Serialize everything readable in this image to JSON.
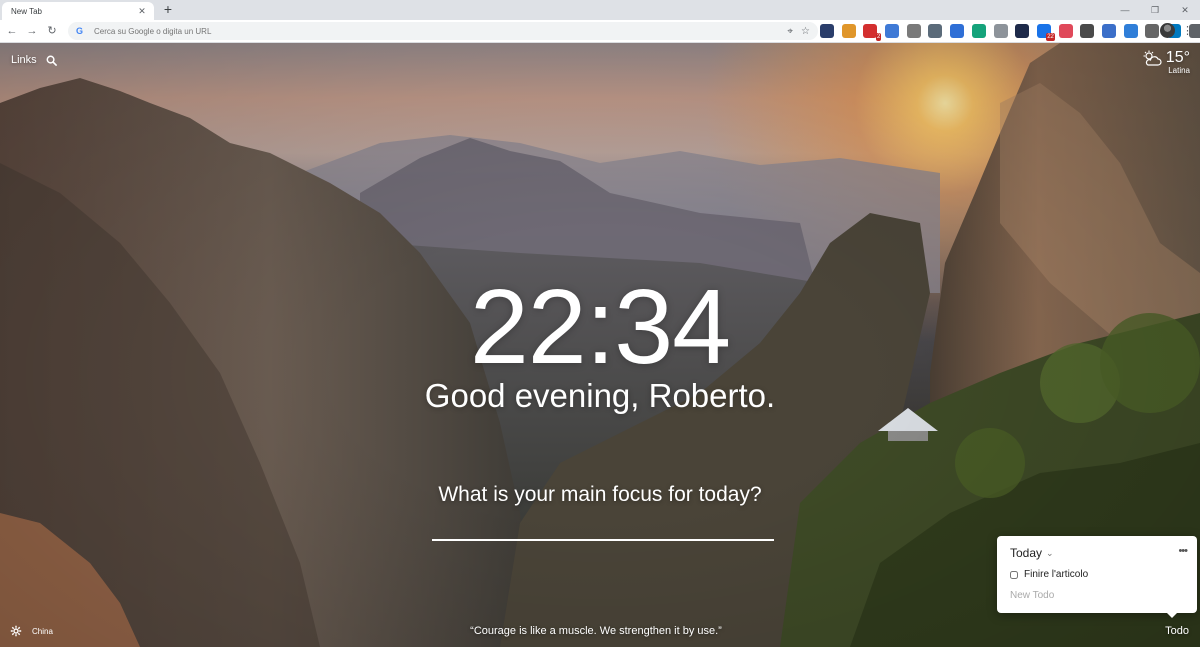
{
  "browser": {
    "tab_title": "New Tab",
    "tab_close": "✕",
    "new_tab": "+",
    "controls": {
      "minimize": "—",
      "restore": "❐",
      "close": "✕"
    },
    "nav": {
      "back": "←",
      "forward": "→",
      "reload": "↻"
    },
    "omnibox_placeholder": "Cerca su Google o digita un URL",
    "omnibox_icon": "G",
    "extensions": [
      {
        "name": "pocket-ext-icon",
        "color": "#2b3e6b",
        "badge": ""
      },
      {
        "name": "feather-ext-icon",
        "color": "#e0962a",
        "badge": ""
      },
      {
        "name": "red-ext-icon",
        "color": "#d32f2f",
        "badge": "2"
      },
      {
        "name": "blue-ext-icon",
        "color": "#3f7ad6",
        "badge": ""
      },
      {
        "name": "shield-ext-icon",
        "color": "#7a7a7a",
        "badge": ""
      },
      {
        "name": "gear-ext-icon",
        "color": "#5b6b7a",
        "badge": ""
      },
      {
        "name": "translate-ext-icon",
        "color": "#2f6fd6",
        "badge": ""
      },
      {
        "name": "grammarly-ext-icon",
        "color": "#15a37b",
        "badge": ""
      },
      {
        "name": "grey-ext-icon",
        "color": "#8d939a",
        "badge": ""
      },
      {
        "name": "diamond-ext-icon",
        "color": "#1e2a4a",
        "badge": ""
      },
      {
        "name": "notification-ext-icon",
        "color": "#1a73e8",
        "badge": "22"
      },
      {
        "name": "pocket-save-ext-icon",
        "color": "#e0495a",
        "badge": ""
      },
      {
        "name": "photo-ext-icon",
        "color": "#4a4a4a",
        "badge": ""
      },
      {
        "name": "calendar-ext-icon",
        "color": "#3b6fc9",
        "badge": ""
      },
      {
        "name": "pin-ext-icon",
        "color": "#2f7ed8",
        "badge": ""
      },
      {
        "name": "camera-ext-icon",
        "color": "#666666",
        "badge": ""
      },
      {
        "name": "trello-ext-icon",
        "color": "#0079bf",
        "badge": ""
      },
      {
        "name": "puzzle-ext-icon",
        "color": "#5f6368",
        "badge": ""
      }
    ],
    "menu": "⋮"
  },
  "momentum": {
    "links_label": "Links",
    "weather": {
      "temp": "15°",
      "location": "Latina"
    },
    "clock": "22:34",
    "greeting": "Good evening, Roberto.",
    "focus_question": "What is your main focus for today?",
    "photo_location": "China",
    "quote": "“Courage is like a muscle. We strengthen it by use.”",
    "todo_button": "Todo",
    "todo": {
      "list_name": "Today",
      "more": "•••",
      "items": [
        {
          "text": "Finire l'articolo",
          "done": false
        }
      ],
      "new_placeholder": "New Todo"
    }
  }
}
